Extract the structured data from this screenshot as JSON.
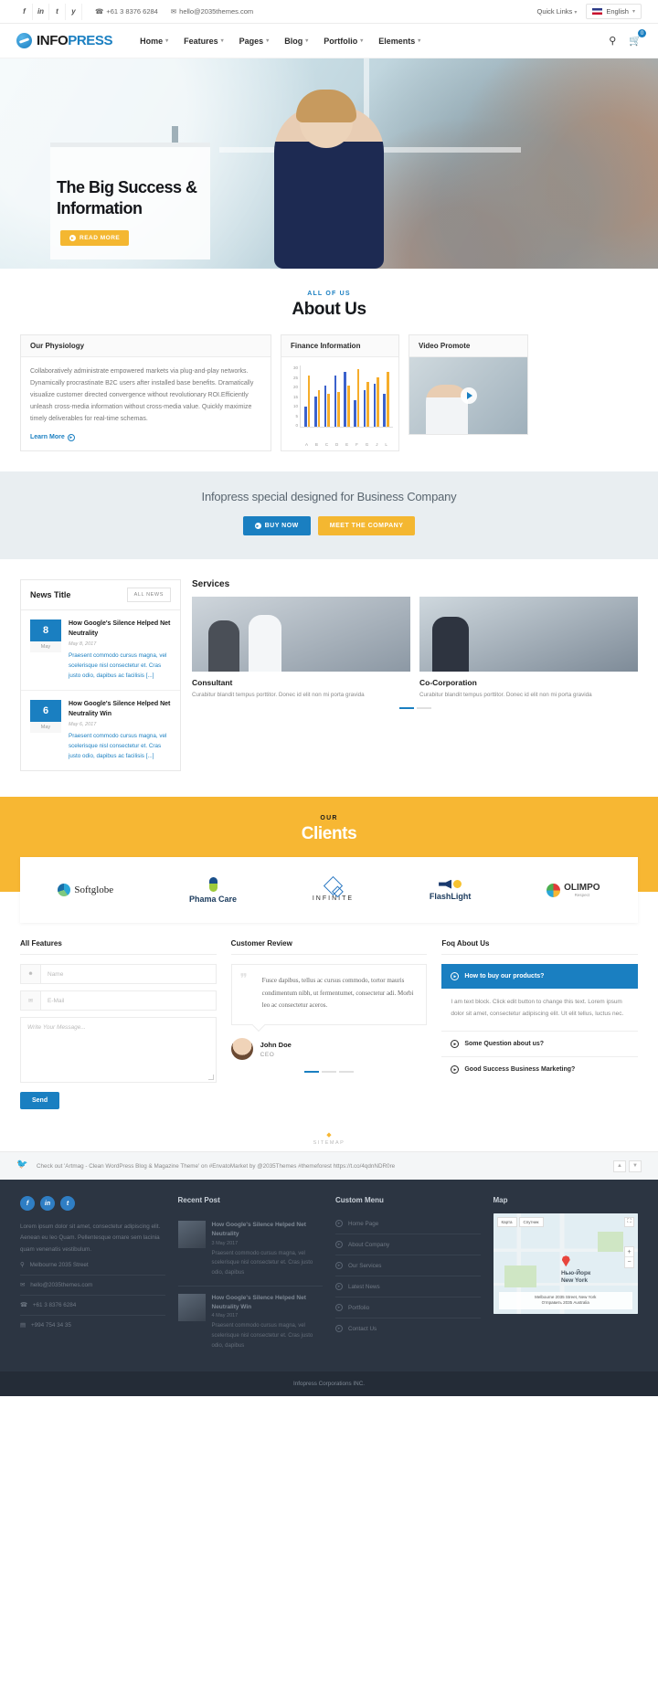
{
  "topbar": {
    "social": [
      "f",
      "in",
      "t",
      "y"
    ],
    "phone": "+61 3 8376 6284",
    "email": "hello@2035themes.com",
    "quick_links": "Quick Links",
    "language": "English"
  },
  "nav": {
    "logo_a": "INFO",
    "logo_b": "PRESS",
    "menu": [
      "Home",
      "Features",
      "Pages",
      "Blog",
      "Portfolio",
      "Elements"
    ],
    "cart_count": "0"
  },
  "hero": {
    "title": "The Big Success & Information",
    "button": "READ MORE"
  },
  "about": {
    "eyebrow": "ALL OF US",
    "title": "About Us",
    "card1": {
      "head": "Our Physiology",
      "body": "Collaboratively administrate empowered markets via plug-and-play networks. Dynamically procrastinate B2C users after installed base benefits. Dramatically visualize customer directed convergence without revolutionary ROI.Efficiently unleash cross-media information without cross-media value. Quickly maximize timely deliverables for real-time schemas.",
      "link": "Learn More"
    },
    "card2": {
      "head": "Finance Information"
    },
    "card3": {
      "head": "Video Promote"
    }
  },
  "chart_data": {
    "type": "bar",
    "title": "Finance Information",
    "categories": [
      "A",
      "B",
      "C",
      "D",
      "E",
      "F",
      "G",
      "J",
      "L"
    ],
    "series": [
      {
        "name": "Series 1",
        "color": "#3b62cc",
        "values": [
          10,
          15,
          20,
          25,
          27,
          13,
          18,
          21,
          16
        ]
      },
      {
        "name": "Series 2",
        "color": "#f6ad2b",
        "values": [
          25,
          18,
          16,
          17,
          20,
          28,
          22,
          24,
          27
        ]
      }
    ],
    "ylim": [
      0,
      30
    ],
    "yticks": [
      30,
      25,
      20,
      15,
      10,
      5,
      0
    ],
    "xlabel": "",
    "ylabel": "",
    "grid": true,
    "legend": "none"
  },
  "cta": {
    "headline": "Infopress special designed for Business Company",
    "buy": "BUY NOW",
    "meet": "MEET THE COMPANY"
  },
  "news": {
    "title": "News Title",
    "all": "ALL NEWS",
    "items": [
      {
        "day": "8",
        "month": "May",
        "headline": "How Google's Silence Helped Net Neutrality",
        "date": "May 8, 2017",
        "body": "Praesent commodo cursus magna, vel scelerisque nisl consectetur et. Cras justo odio, dapibus ac facilisis",
        "more": "[...]"
      },
      {
        "day": "6",
        "month": "May",
        "headline": "How Google's Silence Helped Net Neutrality Win",
        "date": "May 6, 2017",
        "body": "Praesent commodo cursus magna, vel scelerisque nisl consectetur et. Cras justo odio, dapibus ac facilisis",
        "more": "[...]"
      }
    ]
  },
  "services": {
    "title": "Services",
    "items": [
      {
        "name": "Consultant",
        "desc": "Curabitur blandit tempus porttitor. Donec id elit non mi porta gravida"
      },
      {
        "name": "Co-Corporation",
        "desc": "Curabitur blandit tempus porttitor. Donec id elit non mi porta gravida"
      }
    ]
  },
  "clients": {
    "eyebrow": "OUR",
    "title": "Clients",
    "logos": [
      {
        "name": "Softglobe",
        "icon": "globe-icon"
      },
      {
        "name": "Phama Care",
        "icon": "pill-icon"
      },
      {
        "name": "INFINITE",
        "icon": "diamond-icon"
      },
      {
        "name": "FlashLight",
        "icon": "megaphone-icon"
      },
      {
        "name": "OLIMPO",
        "sub": "Respect",
        "icon": "pinwheel-icon"
      }
    ]
  },
  "forms": {
    "features": {
      "head": "All Features",
      "name_placeholder": "Name",
      "email_placeholder": "E-Mail",
      "message_placeholder": "Write Your Message...",
      "send": "Send"
    },
    "review": {
      "head": "Customer Review",
      "quote": "Fusce dapibus, tellus ac cursus commodo, tortor mauris condimentum nibh, ut fermentumet, consectetur adi. Morbi leo ac consectetur aceros.",
      "author": "John Doe",
      "role": "CEO"
    },
    "faq": {
      "head": "Foq About Us",
      "open_q": "How to buy our products?",
      "open_a": "I am text block. Click edit button to change this text. Lorem ipsum dolor sit amet, consectetur adipiscing elit. Ut elit tellus, luctus nec.",
      "items": [
        "Some Question about us?",
        "Good Success Business Marketing?"
      ]
    }
  },
  "sitemap": {
    "label": "SITEMAP"
  },
  "tweet": {
    "text": "Check out 'Artmag - Clean WordPress Blog & Magazine Theme' on #EnvatoMarket by @2035Themes #themeforest https://t.co/4qdnNDR0re",
    "prev": "▲",
    "next": "▼"
  },
  "footer": {
    "social": [
      "f",
      "in",
      "t"
    ],
    "about_text": "Lorem ipsum dolor sit amet, consectetur adipiscing elit. Aenean eu leo Quam. Pellentesque ornare sem lacinia quam venenatis vestibulum.",
    "contacts": [
      {
        "icon": "location-icon",
        "text": "Melbourne 2035 Street"
      },
      {
        "icon": "mail-icon",
        "text": "hello@2035themes.com"
      },
      {
        "icon": "phone-icon",
        "text": "+61 3 8376 6284"
      },
      {
        "icon": "fax-icon",
        "text": "+994 754 34 35"
      }
    ],
    "recent_head": "Recent Post",
    "recent": [
      {
        "title": "How Google's Silence Helped Net Neutrality",
        "date": "3 May 2017",
        "body": "Praesent commodo cursus magna, vel scelerisque nisl consectetur et. Cras justo odio, dapibus"
      },
      {
        "title": "How Google's Silence Helped Net Neutrality Win",
        "date": "4 May 2017",
        "body": "Praesent commodo cursus magna, vel scelerisque nisl consectetur et. Cras justo odio, dapibus"
      }
    ],
    "custom_head": "Custom Menu",
    "custom_items": [
      "Home Page",
      "About Company",
      "Our Services",
      "Latest News",
      "Portfolio",
      "Contact Us"
    ],
    "map_head": "Map",
    "map": {
      "tab1": "Карта",
      "tab2": "Спутник",
      "pin_label": "Нью-Йорк\nNew York",
      "address": "Melbourne 2035 Street, New York\nОтправить 2035 Australia"
    }
  },
  "copyright": "Infopress Corporations INC."
}
